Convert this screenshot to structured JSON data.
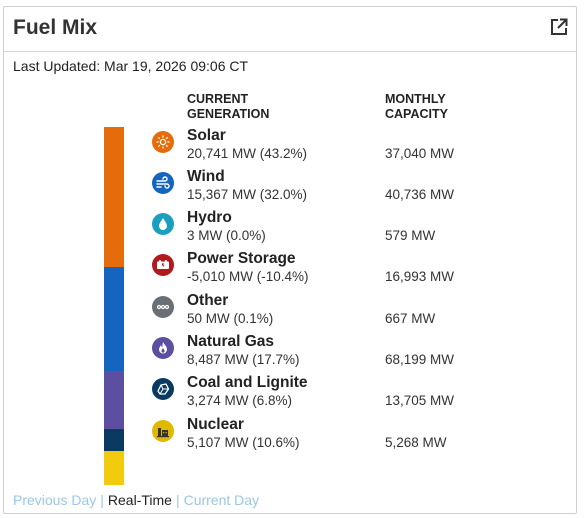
{
  "header": {
    "title": "Fuel Mix",
    "external_icon": "external-link-icon"
  },
  "last_updated": "Last Updated: Mar 19, 2026 09:06 CT",
  "columns": {
    "current": "CURRENT GENERATION",
    "capacity": "MONTHLY CAPACITY"
  },
  "stack_share": [
    {
      "fuel": "Solar",
      "fraction": 0.388,
      "color": "#e46c0a"
    },
    {
      "fuel": "Wind",
      "fraction": 0.286,
      "color": "#1565c0"
    },
    {
      "fuel": "Natural Gas",
      "fraction": 0.16,
      "color": "#5c4ea0"
    },
    {
      "fuel": "Coal and Lignite",
      "fraction": 0.061,
      "color": "#0a3a62"
    },
    {
      "fuel": "Nuclear",
      "fraction": 0.095,
      "color": "#f2cc0c"
    }
  ],
  "fuels": [
    {
      "name": "Solar",
      "generation": "20,741 MW (43.2%)",
      "capacity": "37,040 MW",
      "icon": "sun-icon",
      "color": "#e46c0a"
    },
    {
      "name": "Wind",
      "generation": "15,367 MW (32.0%)",
      "capacity": "40,736 MW",
      "icon": "wind-icon",
      "color": "#1565c0"
    },
    {
      "name": "Hydro",
      "generation": "3 MW (0.0%)",
      "capacity": "579 MW",
      "icon": "water-drop-icon",
      "color": "#1a9fc0"
    },
    {
      "name": "Power Storage",
      "generation": "-5,010 MW (-10.4%)",
      "capacity": "16,993 MW",
      "icon": "battery-icon",
      "color": "#b0191e"
    },
    {
      "name": "Other",
      "generation": "50 MW (0.1%)",
      "capacity": "667 MW",
      "icon": "more-dots-icon",
      "color": "#6a6f75"
    },
    {
      "name": "Natural Gas",
      "generation": "8,487 MW (17.7%)",
      "capacity": "68,199 MW",
      "icon": "flame-icon",
      "color": "#5c4ea0"
    },
    {
      "name": "Coal and Lignite",
      "generation": "3,274 MW (6.8%)",
      "capacity": "13,705 MW",
      "icon": "coal-icon",
      "color": "#0a3a62"
    },
    {
      "name": "Nuclear",
      "generation": "5,107 MW (10.6%)",
      "capacity": "5,268 MW",
      "icon": "nuclear-plant-icon",
      "color": "#e0b800"
    }
  ],
  "footer": {
    "previous": "Previous Day",
    "sep1": "|",
    "realtime": "Real-Time",
    "sep2": "|",
    "current": "Current Day"
  }
}
